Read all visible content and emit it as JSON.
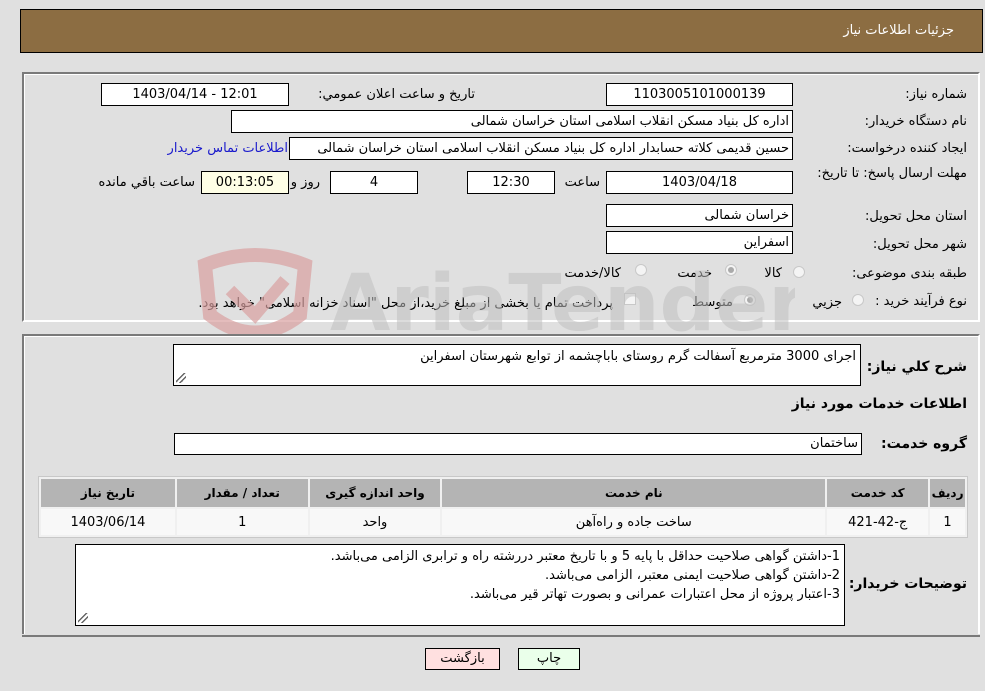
{
  "header": {
    "title": "جزئیات اطلاعات نیاز"
  },
  "info": {
    "need_number_label": "شماره نیاز:",
    "need_number": "1103005101000139",
    "announce_label": "تاریخ و ساعت اعلان عمومي:",
    "announce_value": "1403/04/14 - 12:01",
    "buyer_org_label": "نام دستگاه خریدار:",
    "buyer_org": "اداره کل بنیاد مسکن انقلاب اسلامی استان خراسان شمالی",
    "creator_label": "ایجاد کننده درخواست:",
    "creator": "حسین قدیمی کلاته حسابدار اداره کل بنیاد مسکن انقلاب اسلامی استان خراسان شمالی",
    "contact_link": "اطلاعات تماس خریدار",
    "deadline_label": "مهلت ارسال پاسخ: تا تاریخ:",
    "deadline_date": "1403/04/18",
    "time_label": "ساعت",
    "deadline_time": "12:30",
    "days": "4",
    "days_label": "روز و",
    "remaining_time": "00:13:05",
    "remaining_label": "ساعت باقي مانده",
    "province_label": "استان محل تحویل:",
    "province": "خراسان شمالی",
    "city_label": "شهر محل تحویل:",
    "city": "اسفراین",
    "category_label": "طبقه بندی موضوعی:",
    "category_options": [
      "کالا",
      "خدمت",
      "کالا/خدمت"
    ],
    "category_selected": "خدمت",
    "process_label": "نوع فرآیند خرید :",
    "process_options": [
      "جزیي",
      "متوسط"
    ],
    "process_selected": "متوسط",
    "treasury_text": "پرداخت تمام یا بخشی از مبلغ خرید،از محل \"اسناد خزانه اسلامی\" خواهد بود."
  },
  "details": {
    "summary_label": "شرح کلي نیاز:",
    "summary": "اجرای 3000 مترمربع آسفالت گرم روستای باباچشمه از توابع شهرستان اسفراین",
    "services_heading": "اطلاعات خدمات مورد نیاز",
    "service_group_label": "گروه خدمت:",
    "service_group": "ساختمان",
    "table": {
      "headers": [
        "ردیف",
        "کد خدمت",
        "نام خدمت",
        "واحد اندازه گیری",
        "تعداد / مقدار",
        "تاریخ نیاز"
      ],
      "rows": [
        [
          "1",
          "ج-42-421",
          "ساخت جاده و راه‌آهن",
          "واحد",
          "1",
          "1403/06/14"
        ]
      ]
    },
    "buyer_notes_label": "توضیحات خریدار:",
    "buyer_notes": [
      "1-داشتن گواهی صلاحیت حداقل با پایه 5 و با تاریخ معتبر دررشته راه و ترابری الزامی می‌باشد.",
      "2-داشتن گواهی صلاحیت ایمنی معتبر، الزامی می‌باشد.",
      "3-اعتبار پروژه از محل اعتبارات عمرانی و بصورت تهاتر قیر می‌باشد."
    ]
  },
  "buttons": {
    "print": "چاپ",
    "back": "بازگشت"
  },
  "watermark": {
    "text": "AriaTender.neT"
  }
}
